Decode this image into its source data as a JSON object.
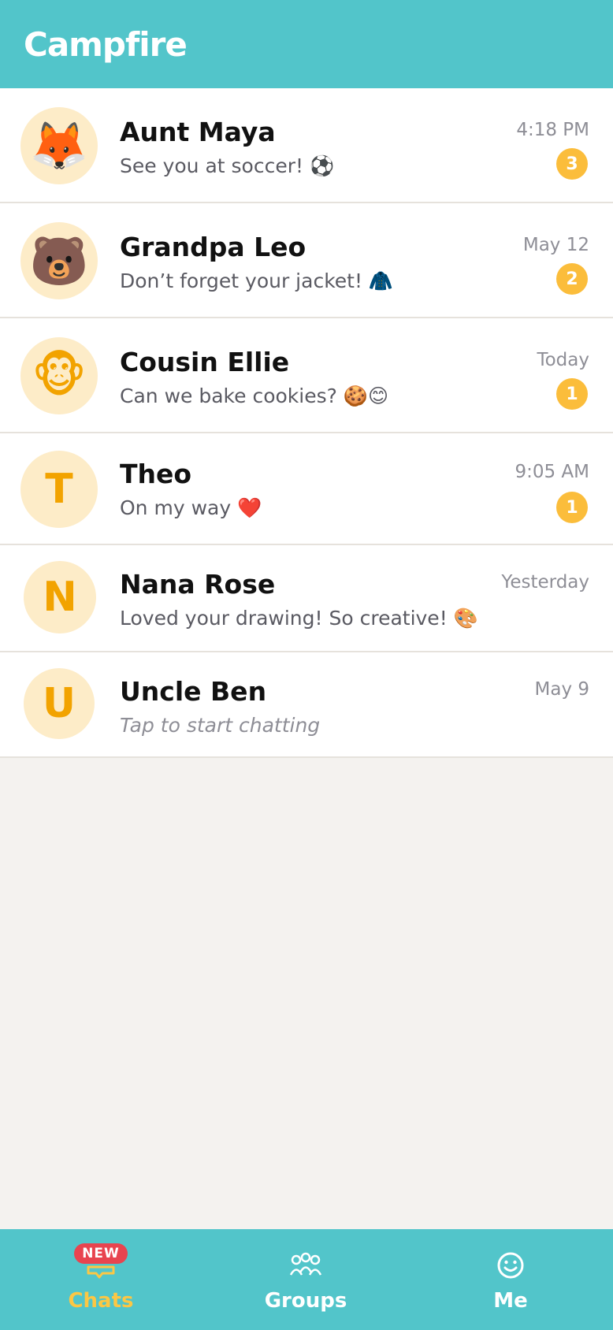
{
  "app": {
    "title": "Campfire"
  },
  "chats": [
    {
      "name": "Aunt Maya",
      "preview": "See you at soccer! ⚽",
      "time": "4:18 PM",
      "unread": "3",
      "avatar": "🦊"
    },
    {
      "name": "Grandpa Leo",
      "preview": "Don’t forget your jacket! 🧥",
      "time": "May 12",
      "unread": "2",
      "avatar": "🐻"
    },
    {
      "name": "Cousin Ellie",
      "preview": "Can we bake cookies? 🍪😊",
      "time": "Today",
      "unread": "1",
      "avatar": "🐵"
    },
    {
      "name": "Theo",
      "preview": "On my way ❤️",
      "time": "9:05 AM",
      "unread": "1",
      "avatar": "T"
    },
    {
      "name": "Nana Rose",
      "preview": "Loved your drawing! So creative! 🎨",
      "time": "Yesterday",
      "unread": "",
      "avatar": "N"
    },
    {
      "name": "Uncle Ben",
      "preview": "Tap to start chatting",
      "time": "May 9",
      "unread": "",
      "avatar": "U"
    }
  ],
  "tabbar": {
    "new_badge": "NEW",
    "tabs": [
      {
        "label": "Chats",
        "icon": "chat-bubble-icon",
        "active": true
      },
      {
        "label": "Groups",
        "icon": "group-icon",
        "active": false
      },
      {
        "label": "Me",
        "icon": "smiley-icon",
        "active": false
      }
    ]
  },
  "colors": {
    "brand": "#52c5ca",
    "badge": "#fbbd3b",
    "active_tab": "#fcc744",
    "new_badge": "#e8444f",
    "avatar_bg": "#fdecc8"
  }
}
